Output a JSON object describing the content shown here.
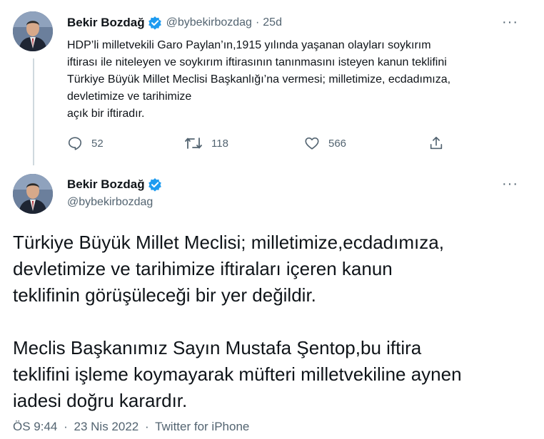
{
  "tweet1": {
    "author": {
      "name": "Bekir Bozdağ",
      "handle": "@bybekirbozdag"
    },
    "separator": "·",
    "age": "25d",
    "more": "···",
    "lines": [
      "HDP’li milletvekili Garo Paylan’ın,1915 yılında yaşanan olayları soykırım",
      "iftirası ile niteleyen ve soykırım iftirasının tanınmasını isteyen kanun teklifini",
      "Türkiye Büyük Millet Meclisi Başkanlığı’na vermesi; milletimize, ecdadımıza,",
      "devletimize ve tarihimize",
      "açık bir iftiradır."
    ],
    "actions": {
      "replies": "52",
      "retweets": "118",
      "likes": "566"
    }
  },
  "tweet2": {
    "author": {
      "name": "Bekir Bozdağ",
      "handle": "@bybekirbozdag"
    },
    "more": "···",
    "lines": [
      "Türkiye Büyük Millet Meclisi; milletimize,ecdadımıza,",
      "devletimize  ve tarihimize iftiraları içeren kanun",
      "teklifinin görüşüleceği bir yer değildir.",
      "",
      "Meclis Başkanımız Sayın Mustafa Şentop,bu iftira",
      "teklifini işleme koymayarak müfteri milletvekiline aynen",
      "iadesi doğru karardır."
    ],
    "meta": {
      "time": "ÖS 9:44",
      "separator": "·",
      "date": "23 Nis 2022",
      "source": "Twitter for iPhone"
    }
  },
  "colors": {
    "verified": "#1d9bf0",
    "secondary": "#536471",
    "thread": "#cfd9de"
  },
  "icons": [
    "reply-icon",
    "retweet-icon",
    "like-icon",
    "share-icon",
    "verified-badge-icon",
    "more-icon"
  ]
}
